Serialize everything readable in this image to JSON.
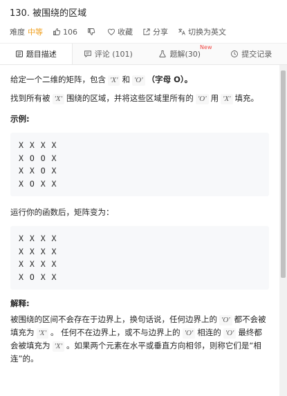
{
  "problem": {
    "title": "130. 被围绕的区域",
    "difficulty_label": "难度",
    "difficulty": "中等",
    "likes": "106",
    "favorite_label": "收藏",
    "share_label": "分享",
    "switch_lang_label": "切换为英文"
  },
  "tabs": [
    {
      "label": "题目描述"
    },
    {
      "label": "评论 (101)"
    },
    {
      "label": "题解(30)",
      "badge": "New"
    },
    {
      "label": "提交记录"
    }
  ],
  "description": {
    "p1_a": "给定一个二维的矩阵，包含",
    "p1_x": "'X'",
    "p1_and": "和",
    "p1_o": "'O'",
    "p1_b": "（字母 O）。",
    "p2_a": "找到所有被",
    "p2_x": "'X'",
    "p2_b": "围绕的区域，并将这些区域里所有的",
    "p2_o": "'O'",
    "p2_c": "用",
    "p2_x2": "'X'",
    "p2_d": "填充。",
    "example_title": "示例:",
    "example_input": [
      "X X X X",
      "X O O X",
      "X X O X",
      "X O X X"
    ],
    "after_text": "运行你的函数后，矩阵变为：",
    "example_output": [
      "X X X X",
      "X X X X",
      "X X X X",
      "X O X X"
    ],
    "explain_title": "解释:",
    "e_a": "被围绕的区间不会存在于边界上，换句话说，任何边界上的",
    "e_o1": "'O'",
    "e_b": "都不会被填充为",
    "e_x1": "'X'",
    "e_c": "。 任何不在边界上，或不与边界上的",
    "e_o2": "'O'",
    "e_d": "相连的",
    "e_o3": "'O'",
    "e_e": "最终都会被填充为",
    "e_x2": "'X'",
    "e_f": "。如果两个元素在水平或垂直方向相邻，则称它们是“相连”的。"
  },
  "icons": {
    "like": "thumbs-up-icon",
    "dislike": "thumbs-down-icon",
    "favorite": "heart-icon",
    "share": "share-icon",
    "translate": "translate-icon",
    "description": "document-icon",
    "comments": "comment-icon",
    "solutions": "flask-icon",
    "submissions": "clock-icon"
  },
  "colors": {
    "difficulty": "#f0a020",
    "new_badge": "#ef4743"
  }
}
